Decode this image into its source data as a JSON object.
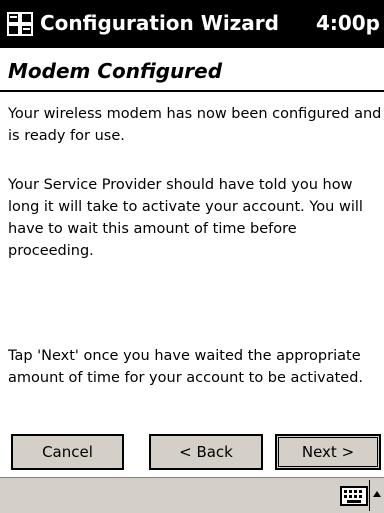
{
  "taskbar": {
    "title": "Configuration Wizard",
    "clock": "4:00p",
    "start_icon": "windows-flag-icon"
  },
  "page": {
    "heading": "Modem Configured",
    "paragraphs": [
      "Your wireless modem has now been configured and is ready for use.",
      "Your Service Provider should have told you how long it will take to activate your account. You will have to wait this amount of time before proceeding.",
      "Tap 'Next' once you have waited the appropriate amount of time for your account to be activated."
    ]
  },
  "buttons": {
    "cancel": "Cancel",
    "back": "< Back",
    "next": "Next >"
  },
  "menubar": {
    "input_icon": "keyboard-icon",
    "input_menu_icon": "up-arrow-icon"
  },
  "colors": {
    "titlebar_bg": "#000000",
    "button_face": "#d4d0c8",
    "text": "#000000",
    "background": "#ffffff"
  }
}
